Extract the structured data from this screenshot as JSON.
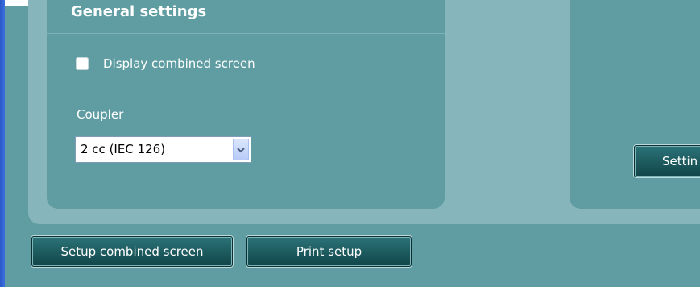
{
  "general_settings": {
    "title": "General settings",
    "display_combined_screen": {
      "label": "Display combined screen",
      "checked": false
    },
    "coupler": {
      "label": "Coupler",
      "selected_value": "2 cc (IEC 126)"
    }
  },
  "right_panel": {
    "settings_button_label": "Settin"
  },
  "buttons": {
    "setup_combined_screen": "Setup combined screen",
    "print_setup": "Print setup"
  },
  "colors": {
    "panel_background": "#5f9da2",
    "outer_panel": "#86b6bb",
    "button_dark": "#114549",
    "text": "#ffffff"
  }
}
